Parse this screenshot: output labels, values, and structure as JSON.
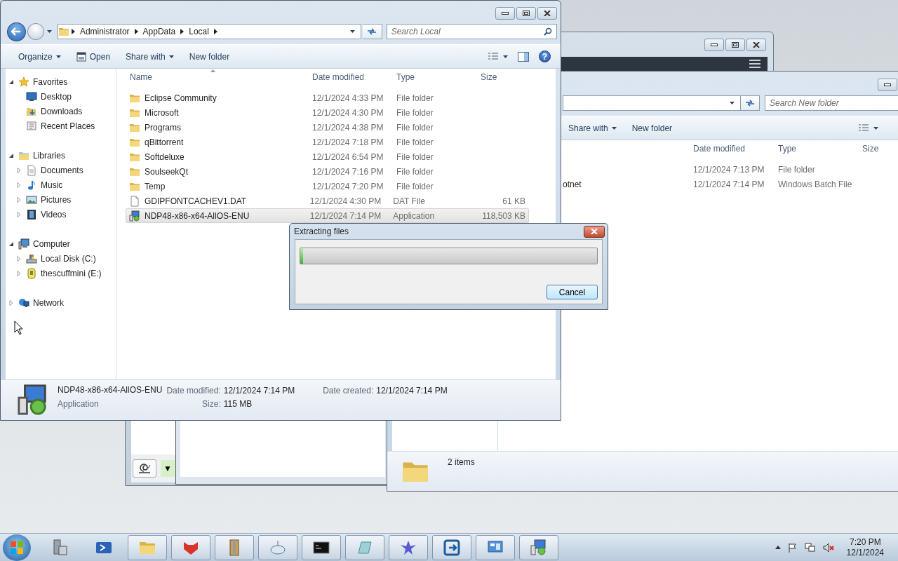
{
  "explorer": {
    "breadcrumb": [
      "Administrator",
      "AppData",
      "Local"
    ],
    "search": {
      "placeholder": "Search Local"
    },
    "toolbar": [
      {
        "label": "Organize",
        "kind": "menu"
      },
      {
        "label": "Open",
        "kind": "icon"
      },
      {
        "label": "Share with",
        "kind": "menu"
      },
      {
        "label": "New folder",
        "kind": "plain"
      }
    ],
    "help": "?",
    "nav": [
      {
        "label": "Favorites",
        "kind": "star",
        "expanded": true,
        "children": [
          {
            "label": "Desktop",
            "kind": "desktop"
          },
          {
            "label": "Downloads",
            "kind": "downloads"
          },
          {
            "label": "Recent Places",
            "kind": "recent"
          }
        ]
      },
      {
        "label": "Libraries",
        "kind": "library",
        "expanded": true,
        "children": [
          {
            "label": "Documents",
            "kind": "document",
            "expanded": false
          },
          {
            "label": "Music",
            "kind": "music",
            "expanded": false
          },
          {
            "label": "Pictures",
            "kind": "pictures",
            "expanded": false
          },
          {
            "label": "Videos",
            "kind": "videos",
            "expanded": false
          }
        ]
      },
      {
        "label": "Computer",
        "kind": "computer",
        "expanded": true,
        "children": [
          {
            "label": "Local Disk (C:)",
            "kind": "disk",
            "expanded": false
          },
          {
            "label": "thescuffmini (E:)",
            "kind": "drive",
            "expanded": false
          }
        ]
      },
      {
        "label": "Network",
        "kind": "network",
        "expanded": false
      }
    ],
    "columns": [
      "Name",
      "Date modified",
      "Type",
      "Size"
    ],
    "rows": [
      {
        "name": "Eclipse Community",
        "date": "12/1/2024 4:33 PM",
        "type": "File folder",
        "kind": "folder",
        "selected": false
      },
      {
        "name": "Microsoft",
        "date": "12/1/2024 4:30 PM",
        "type": "File folder",
        "kind": "folder",
        "selected": false
      },
      {
        "name": "Programs",
        "date": "12/1/2024 4:38 PM",
        "type": "File folder",
        "kind": "folder",
        "selected": false
      },
      {
        "name": "qBittorrent",
        "date": "12/1/2024 7:18 PM",
        "type": "File folder",
        "kind": "folder",
        "selected": false
      },
      {
        "name": "Softdeluxe",
        "date": "12/1/2024 6:54 PM",
        "type": "File folder",
        "kind": "folder",
        "selected": false
      },
      {
        "name": "SoulseekQt",
        "date": "12/1/2024 7:16 PM",
        "type": "File folder",
        "kind": "folder",
        "selected": false
      },
      {
        "name": "Temp",
        "date": "12/1/2024 7:20 PM",
        "type": "File folder",
        "kind": "folder",
        "selected": false
      },
      {
        "name": "GDIPFONTCACHEV1.DAT",
        "date": "12/1/2024 4:30 PM",
        "type": "DAT File",
        "size": "61 KB",
        "kind": "file",
        "selected": false
      },
      {
        "name": "NDP48-x86-x64-AllOS-ENU",
        "date": "12/1/2024 7:14 PM",
        "type": "Application",
        "size": "118,503 KB",
        "kind": "app",
        "selected": true
      }
    ],
    "details": {
      "name": "NDP48-x86-x64-AllOS-ENU",
      "type": "Application",
      "fields": [
        [
          {
            "label": "Date modified:",
            "value": "12/1/2024 7:14 PM"
          },
          {
            "label": "Size:",
            "value": "115 MB"
          }
        ],
        [
          {
            "label": "Date created:",
            "value": "12/1/2024 7:14 PM"
          }
        ]
      ]
    }
  },
  "folder_window": {
    "search": {
      "placeholder": "Search New folder"
    },
    "toolbar": [
      {
        "label": "Share with",
        "kind": "menu"
      },
      {
        "label": "New folder",
        "kind": "plain"
      }
    ],
    "columns": [
      "Date modified",
      "Type",
      "Size"
    ],
    "rows": [
      {
        "date": "12/1/2024 7:13 PM",
        "type": "File folder"
      },
      {
        "name": "otnet",
        "date": "12/1/2024 7:14 PM",
        "type": "Windows Batch File"
      }
    ],
    "status": "2 items"
  },
  "back_window": {
    "chip": "▼"
  },
  "dialog": {
    "title": "Extracting files",
    "level": 0.01,
    "button": "Cancel"
  },
  "taskbar": {
    "items": [
      {
        "kind": "server",
        "running": false
      },
      {
        "kind": "shell",
        "running": false
      },
      {
        "kind": "folder",
        "running": true
      },
      {
        "kind": "shield",
        "running": true
      },
      {
        "kind": "archive",
        "running": true
      },
      {
        "kind": "mouse",
        "running": true
      },
      {
        "kind": "terminal",
        "running": true
      },
      {
        "kind": "tablet",
        "running": true
      },
      {
        "kind": "plane",
        "running": true
      },
      {
        "kind": "exit",
        "running": true
      },
      {
        "kind": "panel",
        "running": true
      },
      {
        "kind": "installer",
        "running": true
      }
    ],
    "time": "7:20 PM",
    "date": "12/1/2024"
  }
}
